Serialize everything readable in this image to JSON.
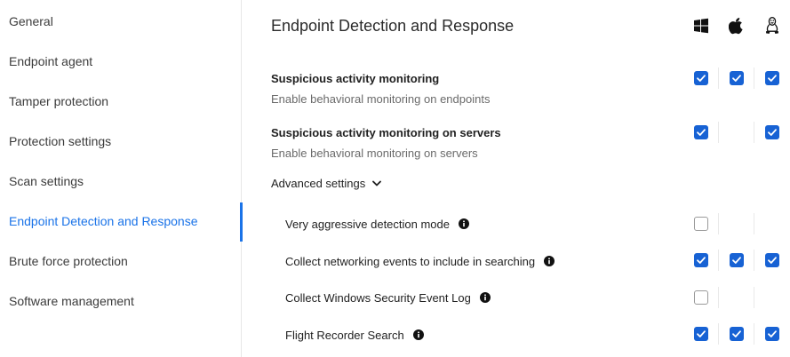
{
  "sidebar": {
    "items": [
      {
        "label": "General",
        "active": false
      },
      {
        "label": "Endpoint agent",
        "active": false
      },
      {
        "label": "Tamper protection",
        "active": false
      },
      {
        "label": "Protection settings",
        "active": false
      },
      {
        "label": "Scan settings",
        "active": false
      },
      {
        "label": "Endpoint Detection and Response",
        "active": true
      },
      {
        "label": "Brute force protection",
        "active": false
      },
      {
        "label": "Software management",
        "active": false
      }
    ]
  },
  "main": {
    "title": "Endpoint Detection and Response",
    "os_columns": [
      {
        "icon": "windows-icon"
      },
      {
        "icon": "apple-icon"
      },
      {
        "icon": "linux-icon"
      }
    ],
    "settings": [
      {
        "title": "Suspicious activity monitoring",
        "description": "Enable behavioral monitoring on endpoints",
        "windows": "checked",
        "mac": "checked",
        "linux": "checked"
      },
      {
        "title": "Suspicious activity monitoring on servers",
        "description": "Enable behavioral monitoring on servers",
        "windows": "checked",
        "mac": "none",
        "linux": "checked"
      }
    ],
    "advanced": {
      "label": "Advanced settings",
      "expanded": true,
      "rows": [
        {
          "label": "Very aggressive detection mode",
          "windows": "unchecked",
          "mac": "none",
          "linux": "none"
        },
        {
          "label": "Collect networking events to include in searching",
          "windows": "checked",
          "mac": "checked",
          "linux": "checked"
        },
        {
          "label": "Collect Windows Security Event Log",
          "windows": "unchecked",
          "mac": "none",
          "linux": "none"
        },
        {
          "label": "Flight Recorder Search",
          "windows": "checked",
          "mac": "checked",
          "linux": "checked"
        }
      ]
    }
  },
  "colors": {
    "accent": "#1a73e8",
    "checkbox_checked": "#1762d4"
  }
}
